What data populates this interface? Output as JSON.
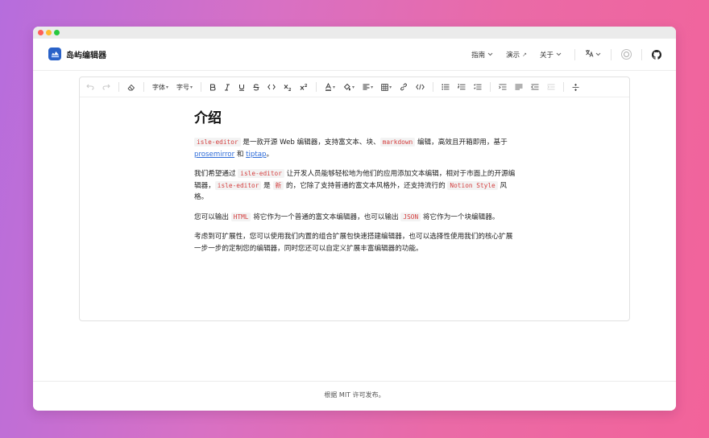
{
  "window": {
    "title": ""
  },
  "header": {
    "brand": "岛屿编辑器",
    "nav": [
      {
        "label": "指南",
        "suffix": "⌄"
      },
      {
        "label": "演示",
        "suffix": "↗"
      },
      {
        "label": "关于",
        "suffix": "⌄"
      }
    ],
    "icons": [
      "translate-icon",
      "theme-toggle-icon",
      "github-icon"
    ]
  },
  "toolbar": {
    "font_family_label": "字体",
    "font_size_label": "字号",
    "items": [
      "undo",
      "redo",
      "clear-format",
      "font-family",
      "font-size",
      "bold",
      "italic",
      "underline",
      "strike",
      "code",
      "subscript",
      "superscript",
      "text-color",
      "highlight",
      "align",
      "table",
      "link",
      "code-block",
      "bullet-list",
      "ordered-list",
      "task-list",
      "indent",
      "outdent",
      "divider"
    ]
  },
  "document": {
    "title": "介绍",
    "p1": {
      "code1": "isle-editor",
      "t1": " 是一款开源 Web 编辑器，支持富文本、块、",
      "code2": "markdown",
      "t2": " 编辑，高效且开箱即用，基于 ",
      "link1": "prosemirror",
      "t3": " 和 ",
      "link2": "tiptap",
      "t4": "。"
    },
    "p2": {
      "t1": "我们希望通过 ",
      "code1": "isle-editor",
      "t2": " 让开发人员能够轻松地为他们的应用添加文本编辑，相对于市面上的开源编辑器，",
      "code2": "isle-editor",
      "t3": " 是 ",
      "code3": "新",
      "t4": " 的，它除了支持普通的富文本风格外，还支持流行的 ",
      "code4": "Notion Style",
      "t5": " 风格。"
    },
    "p3": {
      "t1": "您可以输出 ",
      "code1": "HTML",
      "t2": " 将它作为一个普通的富文本编辑器，也可以输出 ",
      "code2": "JSON",
      "t3": " 将它作为一个块编辑器。"
    },
    "p4": "考虑到可扩展性，您可以使用我们内置的组合扩展包快速搭建编辑器，也可以选择性使用我们的核心扩展一步一步的定制您的编辑器，同时您还可以自定义扩展丰富编辑器的功能。"
  },
  "footer": {
    "text": "根据 MIT 许可发布。"
  },
  "colors": {
    "link": "#2d6bd8",
    "code_text": "#d43f3f",
    "code_bg": "#f3f3f3",
    "brand": "#2a62c8"
  }
}
